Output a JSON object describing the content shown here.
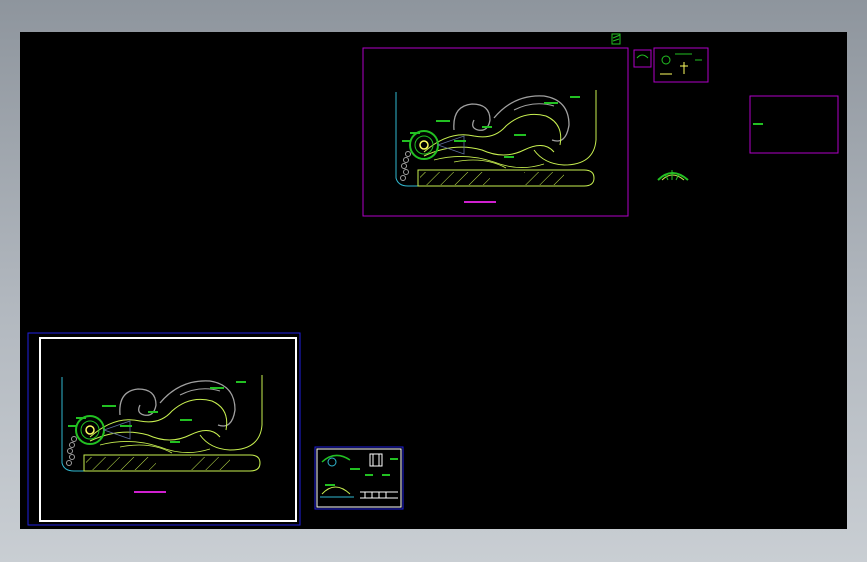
{
  "window": {
    "background": "#000000",
    "frame_gradient": [
      "#8e959d",
      "#c9ced3"
    ]
  },
  "drawing": {
    "colors": {
      "sheet_border": "#b000c8",
      "small_sheet_border": "#2020e0",
      "paper_white": "#ffffff",
      "plan_line": "#c8f050",
      "gray_line": "#a0a0a0",
      "cyan_line": "#30b8d0",
      "label_green": "#22c022",
      "title_magenta": "#d020d0"
    },
    "icons": {
      "round_plaza": "circle-pavilion-icon",
      "path_tiles": "stepping-stone-icon",
      "hatch": "hatch-pattern-icon"
    }
  }
}
